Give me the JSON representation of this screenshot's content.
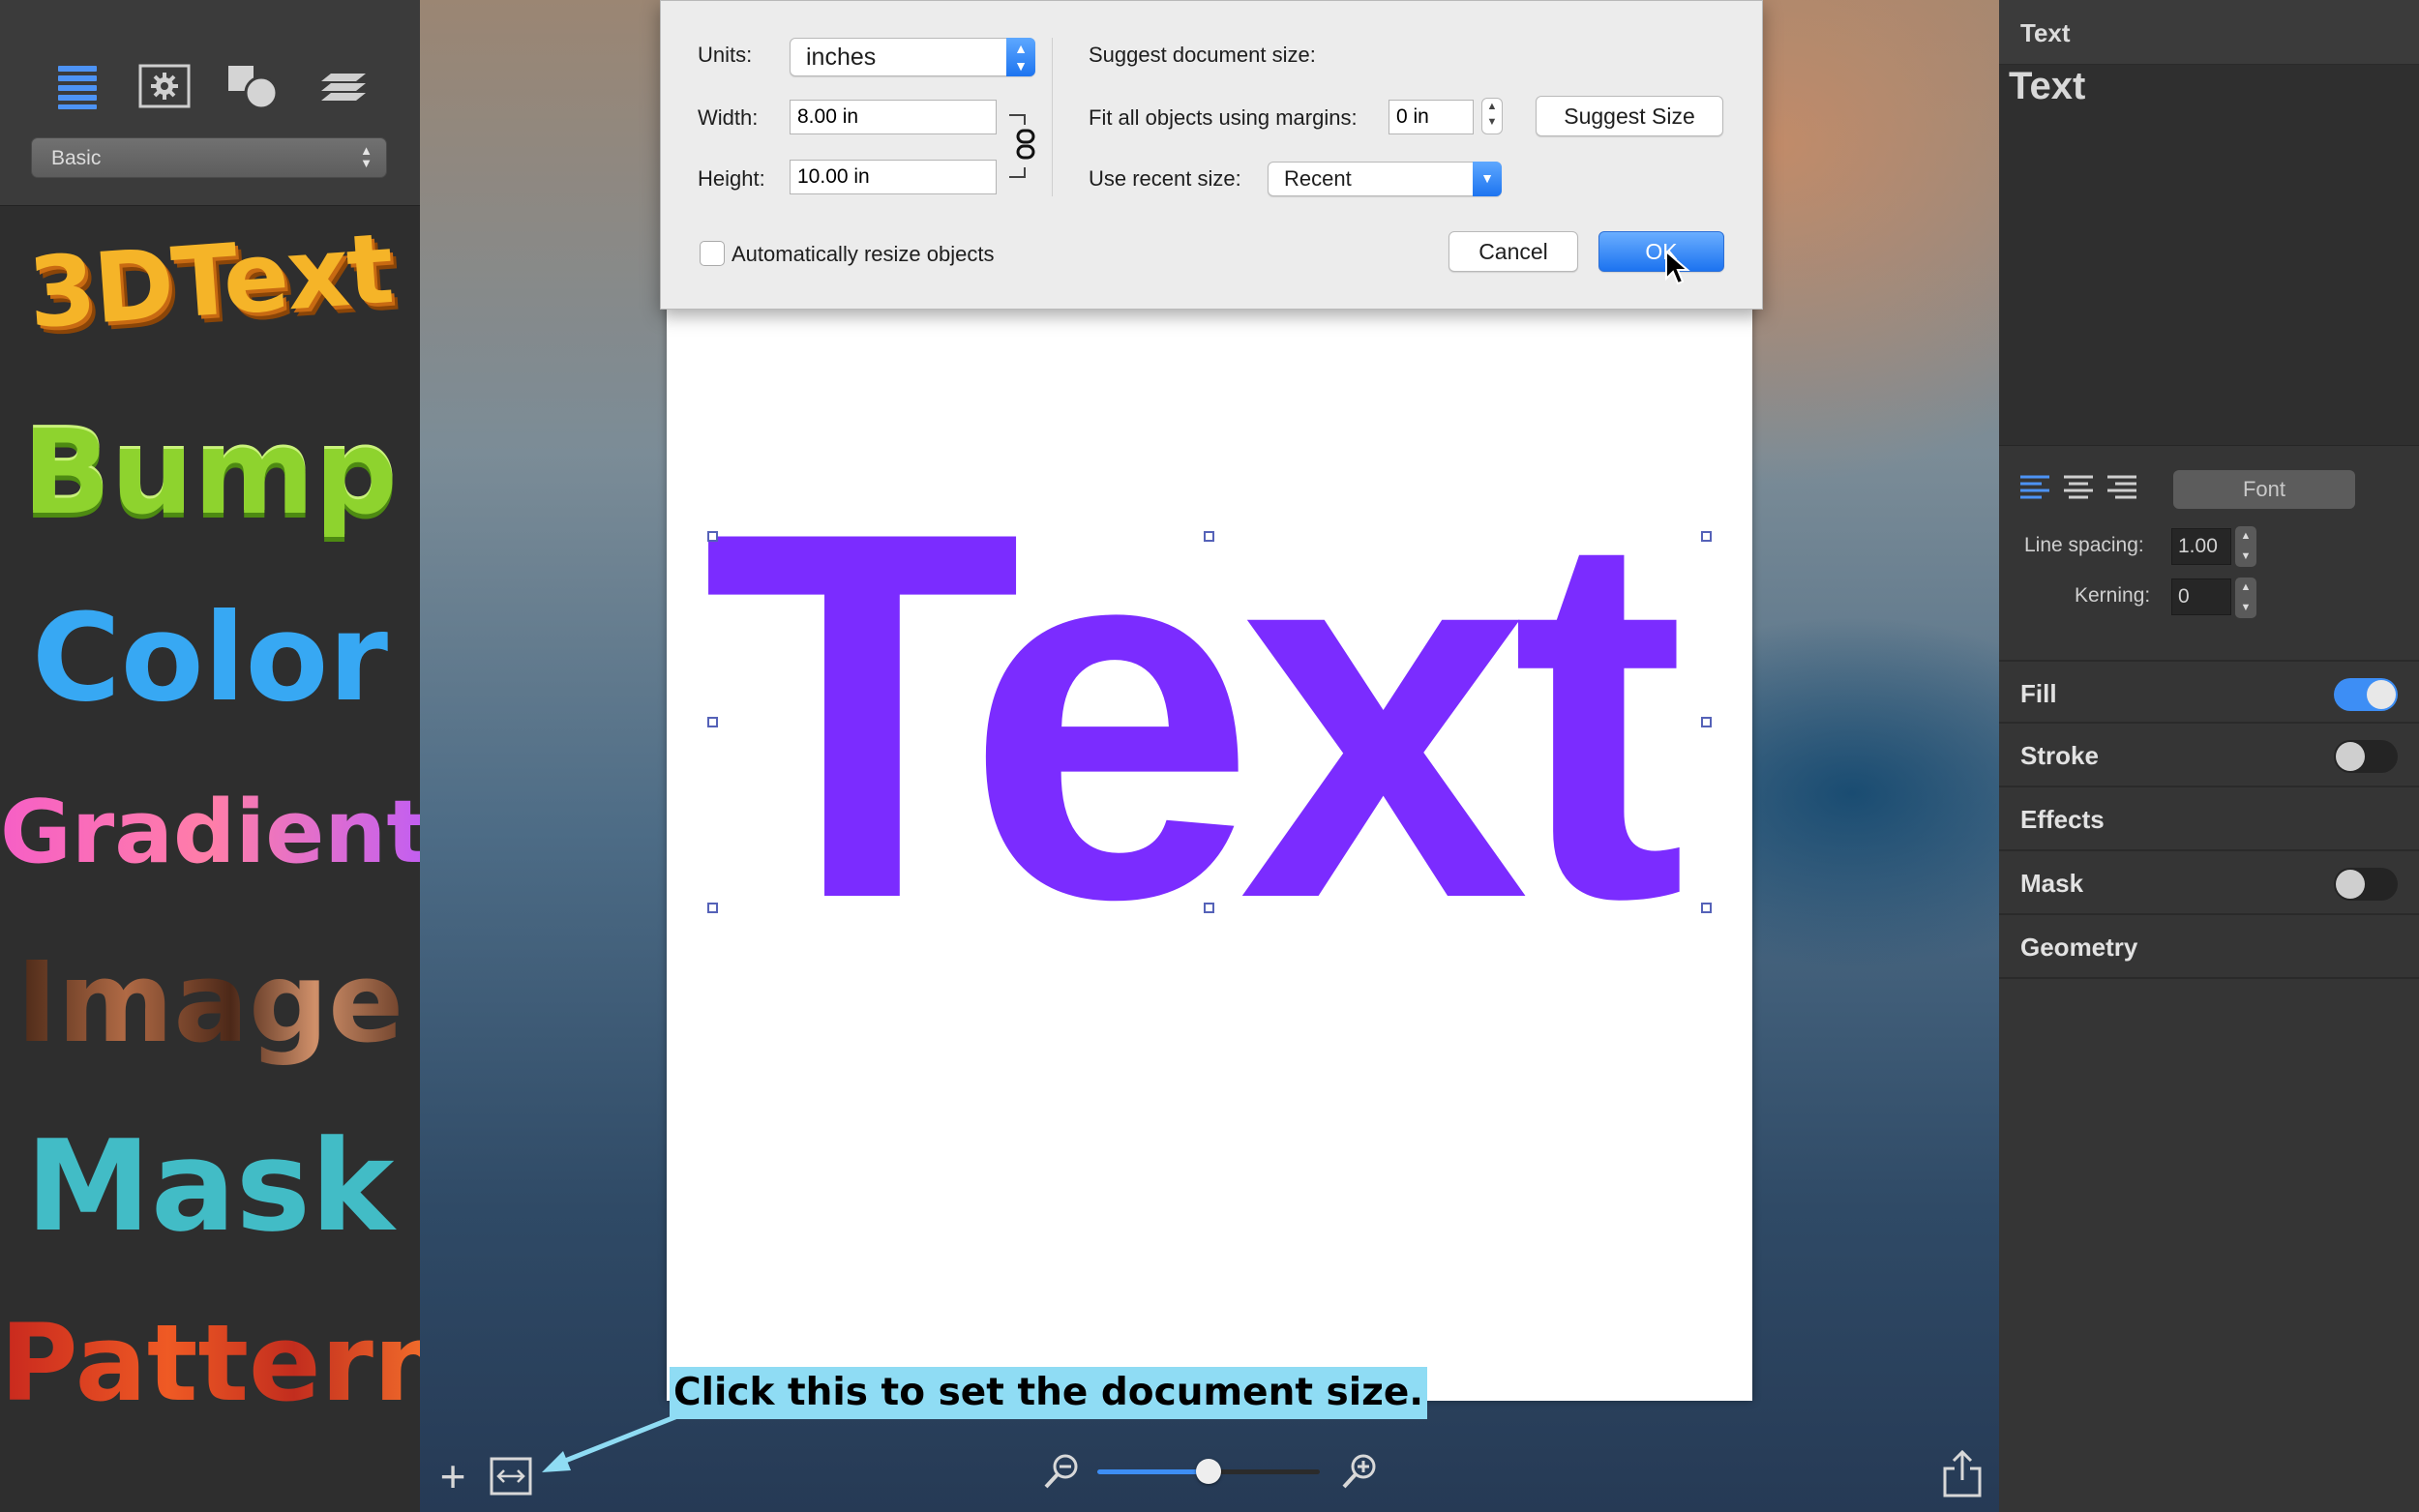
{
  "left_sidebar": {
    "toolbar_icons": [
      "list-icon",
      "gear-box-icon",
      "shapes-icon",
      "layers-icon"
    ],
    "preset_select": "Basic",
    "styles": [
      "3DText",
      "Bump",
      "Color",
      "Gradient",
      "Image",
      "Mask",
      "Pattern"
    ]
  },
  "dialog": {
    "units_label": "Units:",
    "units_value": "inches",
    "width_label": "Width:",
    "width_value": "8.00 in",
    "height_label": "Height:",
    "height_value": "10.00 in",
    "suggest_label": "Suggest document size:",
    "fit_label": "Fit all objects using margins:",
    "fit_value": "0 in",
    "suggest_button": "Suggest Size",
    "recent_label": "Use recent size:",
    "recent_value": "Recent",
    "auto_resize_label": "Automatically resize objects",
    "auto_resize_checked": false,
    "cancel_button": "Cancel",
    "ok_button": "OK"
  },
  "canvas": {
    "text": "Text",
    "text_color": "#7b2cff"
  },
  "tutorial_callout": "Click this to set the document size.",
  "bottom_bar": {
    "zoom_level": 0.5
  },
  "inspector": {
    "header": "Text",
    "text_content": "Text",
    "font_button": "Font",
    "line_spacing_label": "Line spacing:",
    "line_spacing_value": "1.00",
    "kerning_label": "Kerning:",
    "kerning_value": "0",
    "sections": [
      {
        "title": "Fill",
        "toggle": true
      },
      {
        "title": "Stroke",
        "toggle": false
      },
      {
        "title": "Effects"
      },
      {
        "title": "Mask",
        "toggle": false
      },
      {
        "title": "Geometry"
      }
    ]
  },
  "colors": {
    "accent": "#3d8ef5",
    "callout": "#8fdcf4"
  }
}
